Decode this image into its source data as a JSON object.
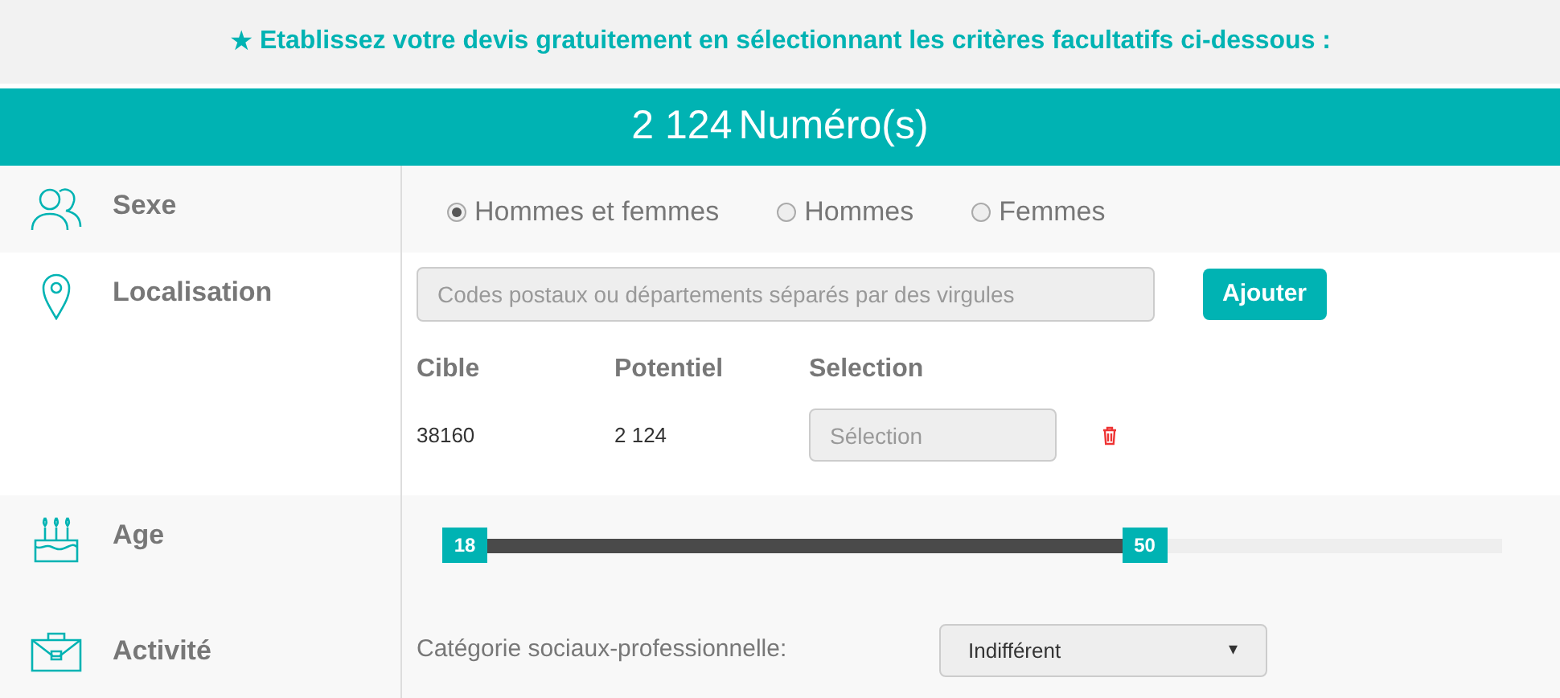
{
  "header": {
    "icon": "★",
    "text": "Etablissez votre devis gratuitement en sélectionnant les critères facultatifs ci-dessous :"
  },
  "count": {
    "value": "2 124",
    "unit": "Numéro(s)"
  },
  "sexe": {
    "label": "Sexe",
    "options": [
      {
        "label": "Hommes et femmes",
        "selected": true
      },
      {
        "label": "Hommes",
        "selected": false
      },
      {
        "label": "Femmes",
        "selected": false
      }
    ]
  },
  "localisation": {
    "label": "Localisation",
    "placeholder": "Codes postaux ou départements séparés par des virgules",
    "add_button": "Ajouter",
    "columns": [
      "Cible",
      "Potentiel",
      "Selection"
    ],
    "rows": [
      {
        "cible": "38160",
        "potentiel": "2 124",
        "selection_placeholder": "Sélection"
      }
    ]
  },
  "age": {
    "label": "Age",
    "min": {
      "value": "18",
      "level": 0
    },
    "max": {
      "value": "50",
      "level": 0.67
    }
  },
  "activite": {
    "label": "Activité",
    "field_label": "Catégorie sociaux-professionnelle:",
    "select_value": "Indifférent",
    "caret": "▾"
  }
}
